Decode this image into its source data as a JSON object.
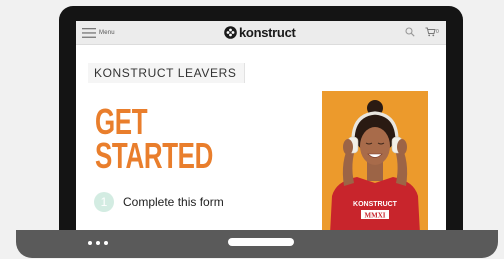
{
  "header": {
    "menu_label": "Menu",
    "logo_text": "konstruct",
    "cart_count": "0"
  },
  "main": {
    "section_title": "KONSTRUCT LEAVERS",
    "headline_line1": "GET",
    "headline_line2": "STARTED",
    "step": {
      "number": "1",
      "text": "Complete this form"
    }
  },
  "photo": {
    "shirt_text_top": "KONSTRUCT",
    "shirt_text_mid": "MMXI"
  },
  "colors": {
    "accent_orange": "#e97e2c",
    "photo_bg": "#ec9a2c",
    "step_circle": "#d3ece2",
    "shirt_red": "#c8252c"
  },
  "icons": {
    "menu": "hamburger-icon",
    "logo": "konstruct-logo-icon",
    "search": "search-icon",
    "cart": "cart-icon"
  }
}
